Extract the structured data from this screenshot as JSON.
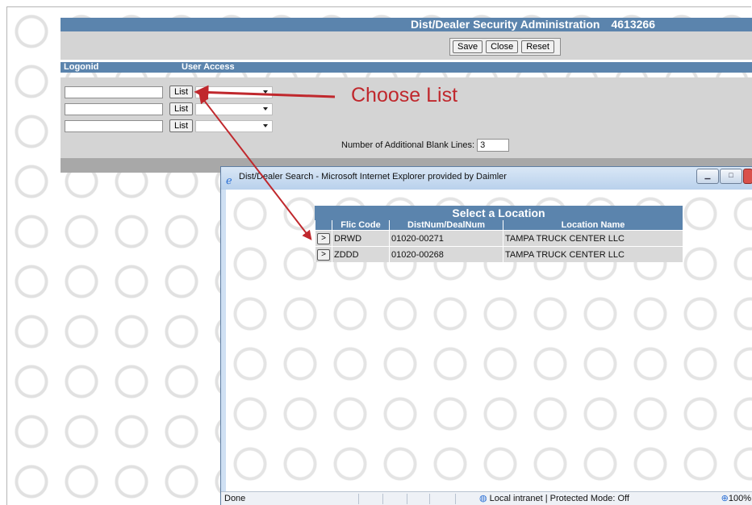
{
  "page": {
    "title": "Dist/Dealer Security Administration",
    "title_number": "4613266",
    "toolbar": {
      "save": "Save",
      "close": "Close",
      "reset": "Reset"
    },
    "columns": {
      "logonid": "Logonid",
      "user_access": "User Access"
    },
    "rows": [
      {
        "logonid": "",
        "list": "List",
        "access": ""
      },
      {
        "logonid": "",
        "list": "List",
        "access": ""
      },
      {
        "logonid": "",
        "list": "List",
        "access": ""
      }
    ],
    "blank_lines_label": "Number of Additional Blank Lines:",
    "blank_lines_value": "3"
  },
  "annotation": {
    "text": "Choose List",
    "color": "#c0282d"
  },
  "popup": {
    "window_title": "Dist/Dealer Search - Microsoft Internet Explorer provided by Daimler",
    "heading": "Select a Location",
    "columns": [
      "",
      "Flic Code",
      "DistNum/DealNum",
      "Location Name"
    ],
    "rows": [
      {
        "button": ">",
        "flic_code": "DRWD",
        "dist_deal": "01020-00271",
        "location": "TAMPA TRUCK CENTER LLC"
      },
      {
        "button": ">",
        "flic_code": "ZDDD",
        "dist_deal": "01020-00268",
        "location": "TAMPA TRUCK CENTER LLC"
      }
    ],
    "status": {
      "left": "Done",
      "zone": "Local intranet | Protected Mode: Off",
      "zoom": "100%"
    }
  },
  "colors": {
    "header_blue": "#5b84ad",
    "band_gray": "#d4d4d4"
  },
  "icons": [
    "ie-icon",
    "globe-icon",
    "zoom-icon",
    "minimize-icon",
    "maximize-icon",
    "close-icon"
  ]
}
